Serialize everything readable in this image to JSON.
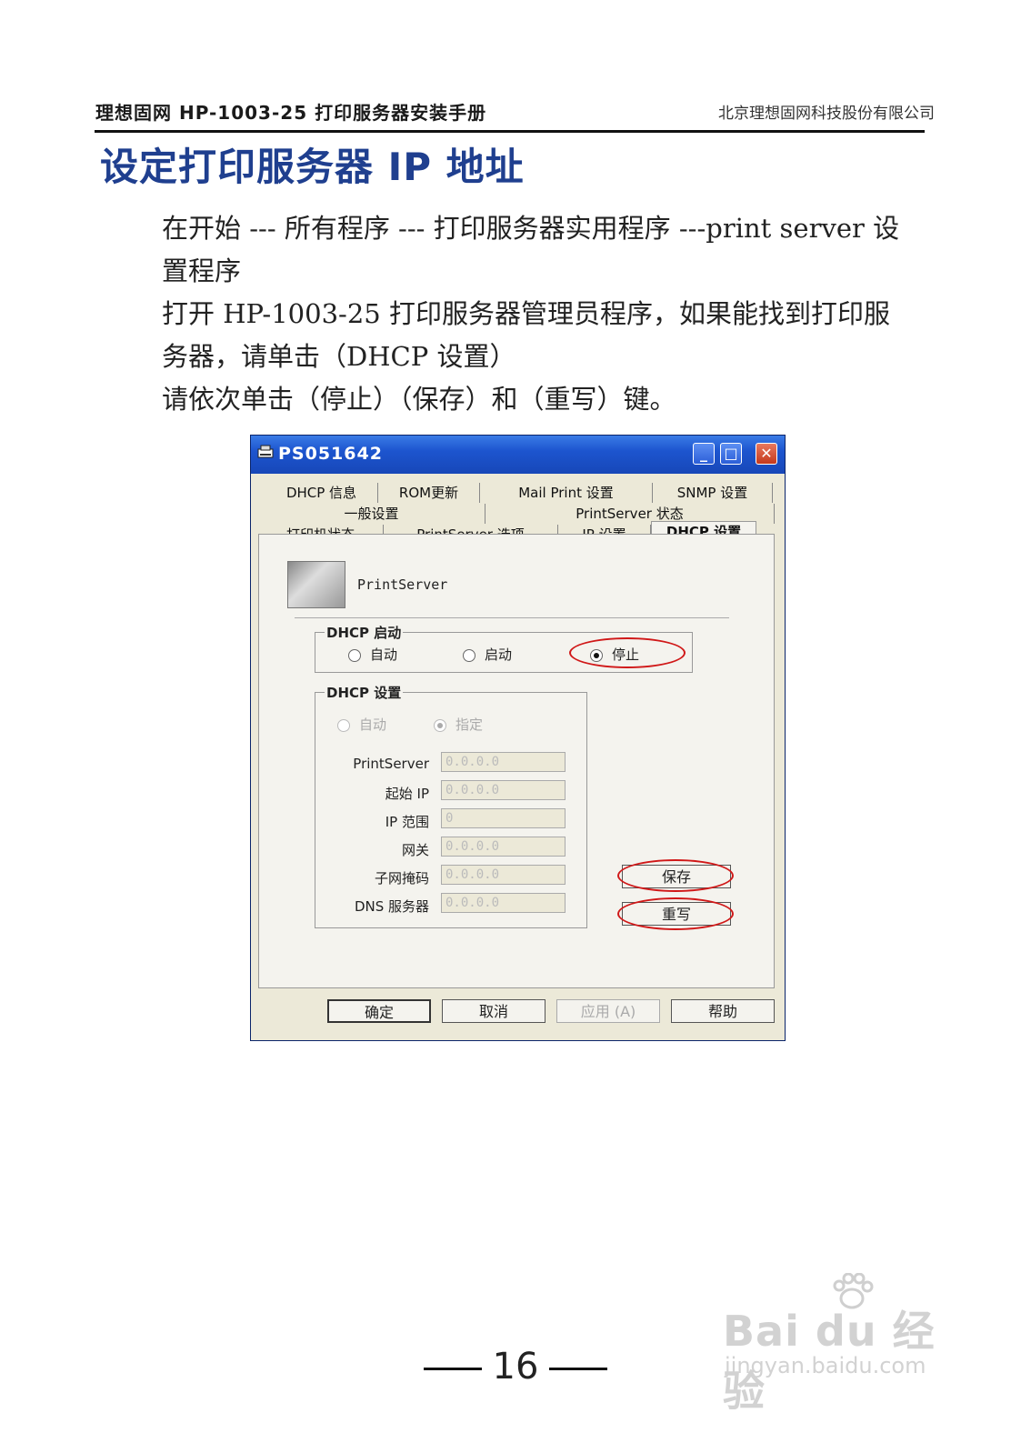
{
  "header": {
    "left": "理想固网  HP-1003-25  打印服务器安装手册",
    "right": "北京理想固网科技股份有限公司"
  },
  "title": "设定打印服务器 IP 地址",
  "paragraphs": [
    "在开始 --- 所有程序 --- 打印服务器实用程序 ---print server 设置程序",
    "打开 HP-1003-25 打印服务器管理员程序，如果能找到打印服务器，请单击（DHCP 设置）",
    "请依次单击（停止）（保存）和（重写）键。"
  ],
  "window": {
    "title": "PS051642",
    "controls": {
      "minimize": "_",
      "maximize": "□",
      "close": "✕"
    },
    "tabs_row1": [
      "DHCP 信息",
      "ROM更新",
      "Mail Print 设置",
      "SNMP 设置"
    ],
    "tabs_row2": [
      "一般设置",
      "PrintServer 状态"
    ],
    "tabs_row3": [
      "打印机状态",
      "PrintServer 选项",
      "IP 设置",
      "DHCP 设置"
    ],
    "active_tab": "DHCP 设置",
    "device_label": "PrintServer",
    "dhcp_start": {
      "title": "DHCP 启动",
      "options": [
        "自动",
        "启动",
        "停止"
      ],
      "selected": "停止"
    },
    "dhcp_settings": {
      "title": "DHCP 设置",
      "options": [
        "自动",
        "指定"
      ],
      "selected": "指定",
      "fields": [
        {
          "label": "PrintServer",
          "value": "0.0.0.0"
        },
        {
          "label": "起始 IP",
          "value": "0.0.0.0"
        },
        {
          "label": "IP 范围",
          "value": "0"
        },
        {
          "label": "网关",
          "value": "0.0.0.0"
        },
        {
          "label": "子网掩码",
          "value": "0.0.0.0"
        },
        {
          "label": "DNS 服务器",
          "value": "0.0.0.0"
        }
      ]
    },
    "side_buttons": {
      "save": "保存",
      "rewrite": "重写"
    },
    "bottom_buttons": {
      "ok": "确定",
      "cancel": "取消",
      "apply": "应用 (A)",
      "help": "帮助"
    },
    "annotation_color": "#d01818"
  },
  "page_number": "16",
  "watermark": {
    "brand": "Bai du 经验",
    "url": "jingyan.baidu.com"
  }
}
